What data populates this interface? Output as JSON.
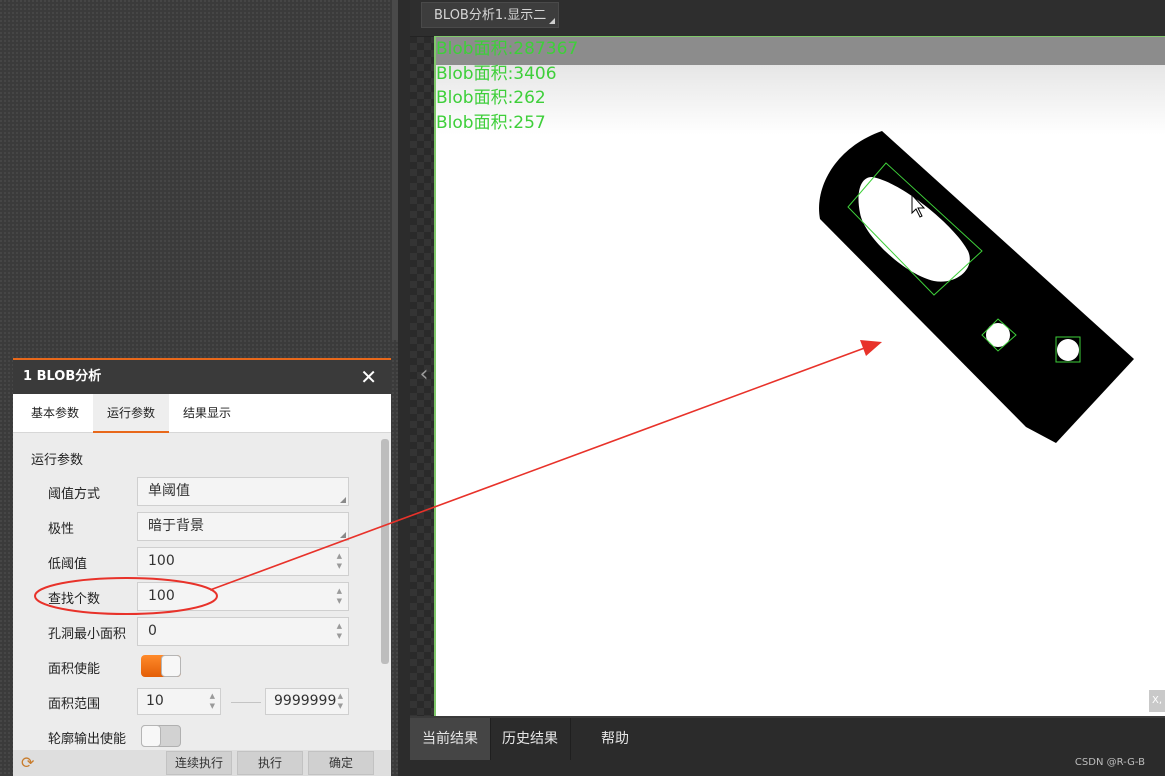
{
  "view": {
    "tab_label": "BLOB分析1.显示二",
    "blob_labels": [
      "Blob面积:287367",
      "Blob面积:3406",
      "Blob面积:262",
      "Blob面积:257"
    ],
    "corner_label": "X,"
  },
  "results_bar": {
    "tabs": [
      "当前结果",
      "历史结果",
      "帮助"
    ]
  },
  "dialog": {
    "title": "1 BLOB分析",
    "tabs": [
      "基本参数",
      "运行参数",
      "结果显示"
    ],
    "section_title": "运行参数",
    "rows": {
      "threshold_mode": {
        "label": "阈值方式",
        "value": "单阈值"
      },
      "polarity": {
        "label": "极性",
        "value": "暗于背景"
      },
      "low_threshold": {
        "label": "低阈值",
        "value": "100"
      },
      "find_count": {
        "label": "查找个数",
        "value": "100"
      },
      "min_hole_area": {
        "label": "孔洞最小面积",
        "value": "0"
      },
      "area_enable": {
        "label": "面积使能",
        "state": "on"
      },
      "area_range": {
        "label": "面积范围",
        "min": "10",
        "max": "9999999"
      },
      "contour_enable": {
        "label": "轮廓输出使能",
        "state": "off"
      }
    },
    "footer": {
      "continuous": "连续执行",
      "execute": "执行",
      "confirm": "确定"
    }
  },
  "watermark": "CSDN @R-G-B",
  "colors": {
    "accent": "#e8681a",
    "annotation_red": "#e8322a",
    "blob_text": "#3ecf3a"
  }
}
